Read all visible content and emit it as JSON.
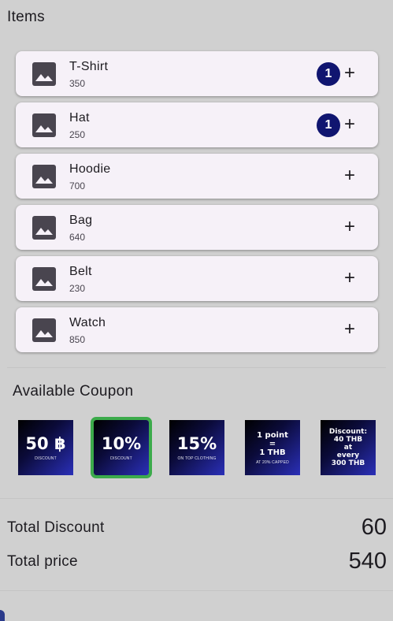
{
  "items_section": {
    "title": "Items"
  },
  "items": [
    {
      "name": "T-Shirt",
      "price": "350",
      "count": "1"
    },
    {
      "name": "Hat",
      "price": "250",
      "count": "1"
    },
    {
      "name": "Hoodie",
      "price": "700",
      "count": ""
    },
    {
      "name": "Bag",
      "price": "640",
      "count": ""
    },
    {
      "name": "Belt",
      "price": "230",
      "count": ""
    },
    {
      "name": "Watch",
      "price": "850",
      "count": ""
    }
  ],
  "add_symbol": "+",
  "coupon_section": {
    "title": "Available Coupon"
  },
  "coupons": [
    {
      "main": "50 ฿",
      "sub": "DISCOUNT",
      "selected": false
    },
    {
      "main": "10%",
      "sub": "DISCOUNT",
      "selected": true
    },
    {
      "main": "15%",
      "sub": "ON TOP CLOTHING",
      "selected": false
    },
    {
      "main": "1 point\n=\n1 THB",
      "sub": "AT 20% CAPPED",
      "selected": false
    },
    {
      "main": "Discount:\n40 THB\nat\nevery\n300 THB",
      "sub": "",
      "selected": false
    }
  ],
  "totals": {
    "discount_label": "Total Discount",
    "discount_value": "60",
    "price_label": "Total price",
    "price_value": "540"
  },
  "colors": {
    "badge": "#101570",
    "selected_border": "#3cab4b",
    "card": "#f6f1f8",
    "background": "#d0d0d0"
  }
}
